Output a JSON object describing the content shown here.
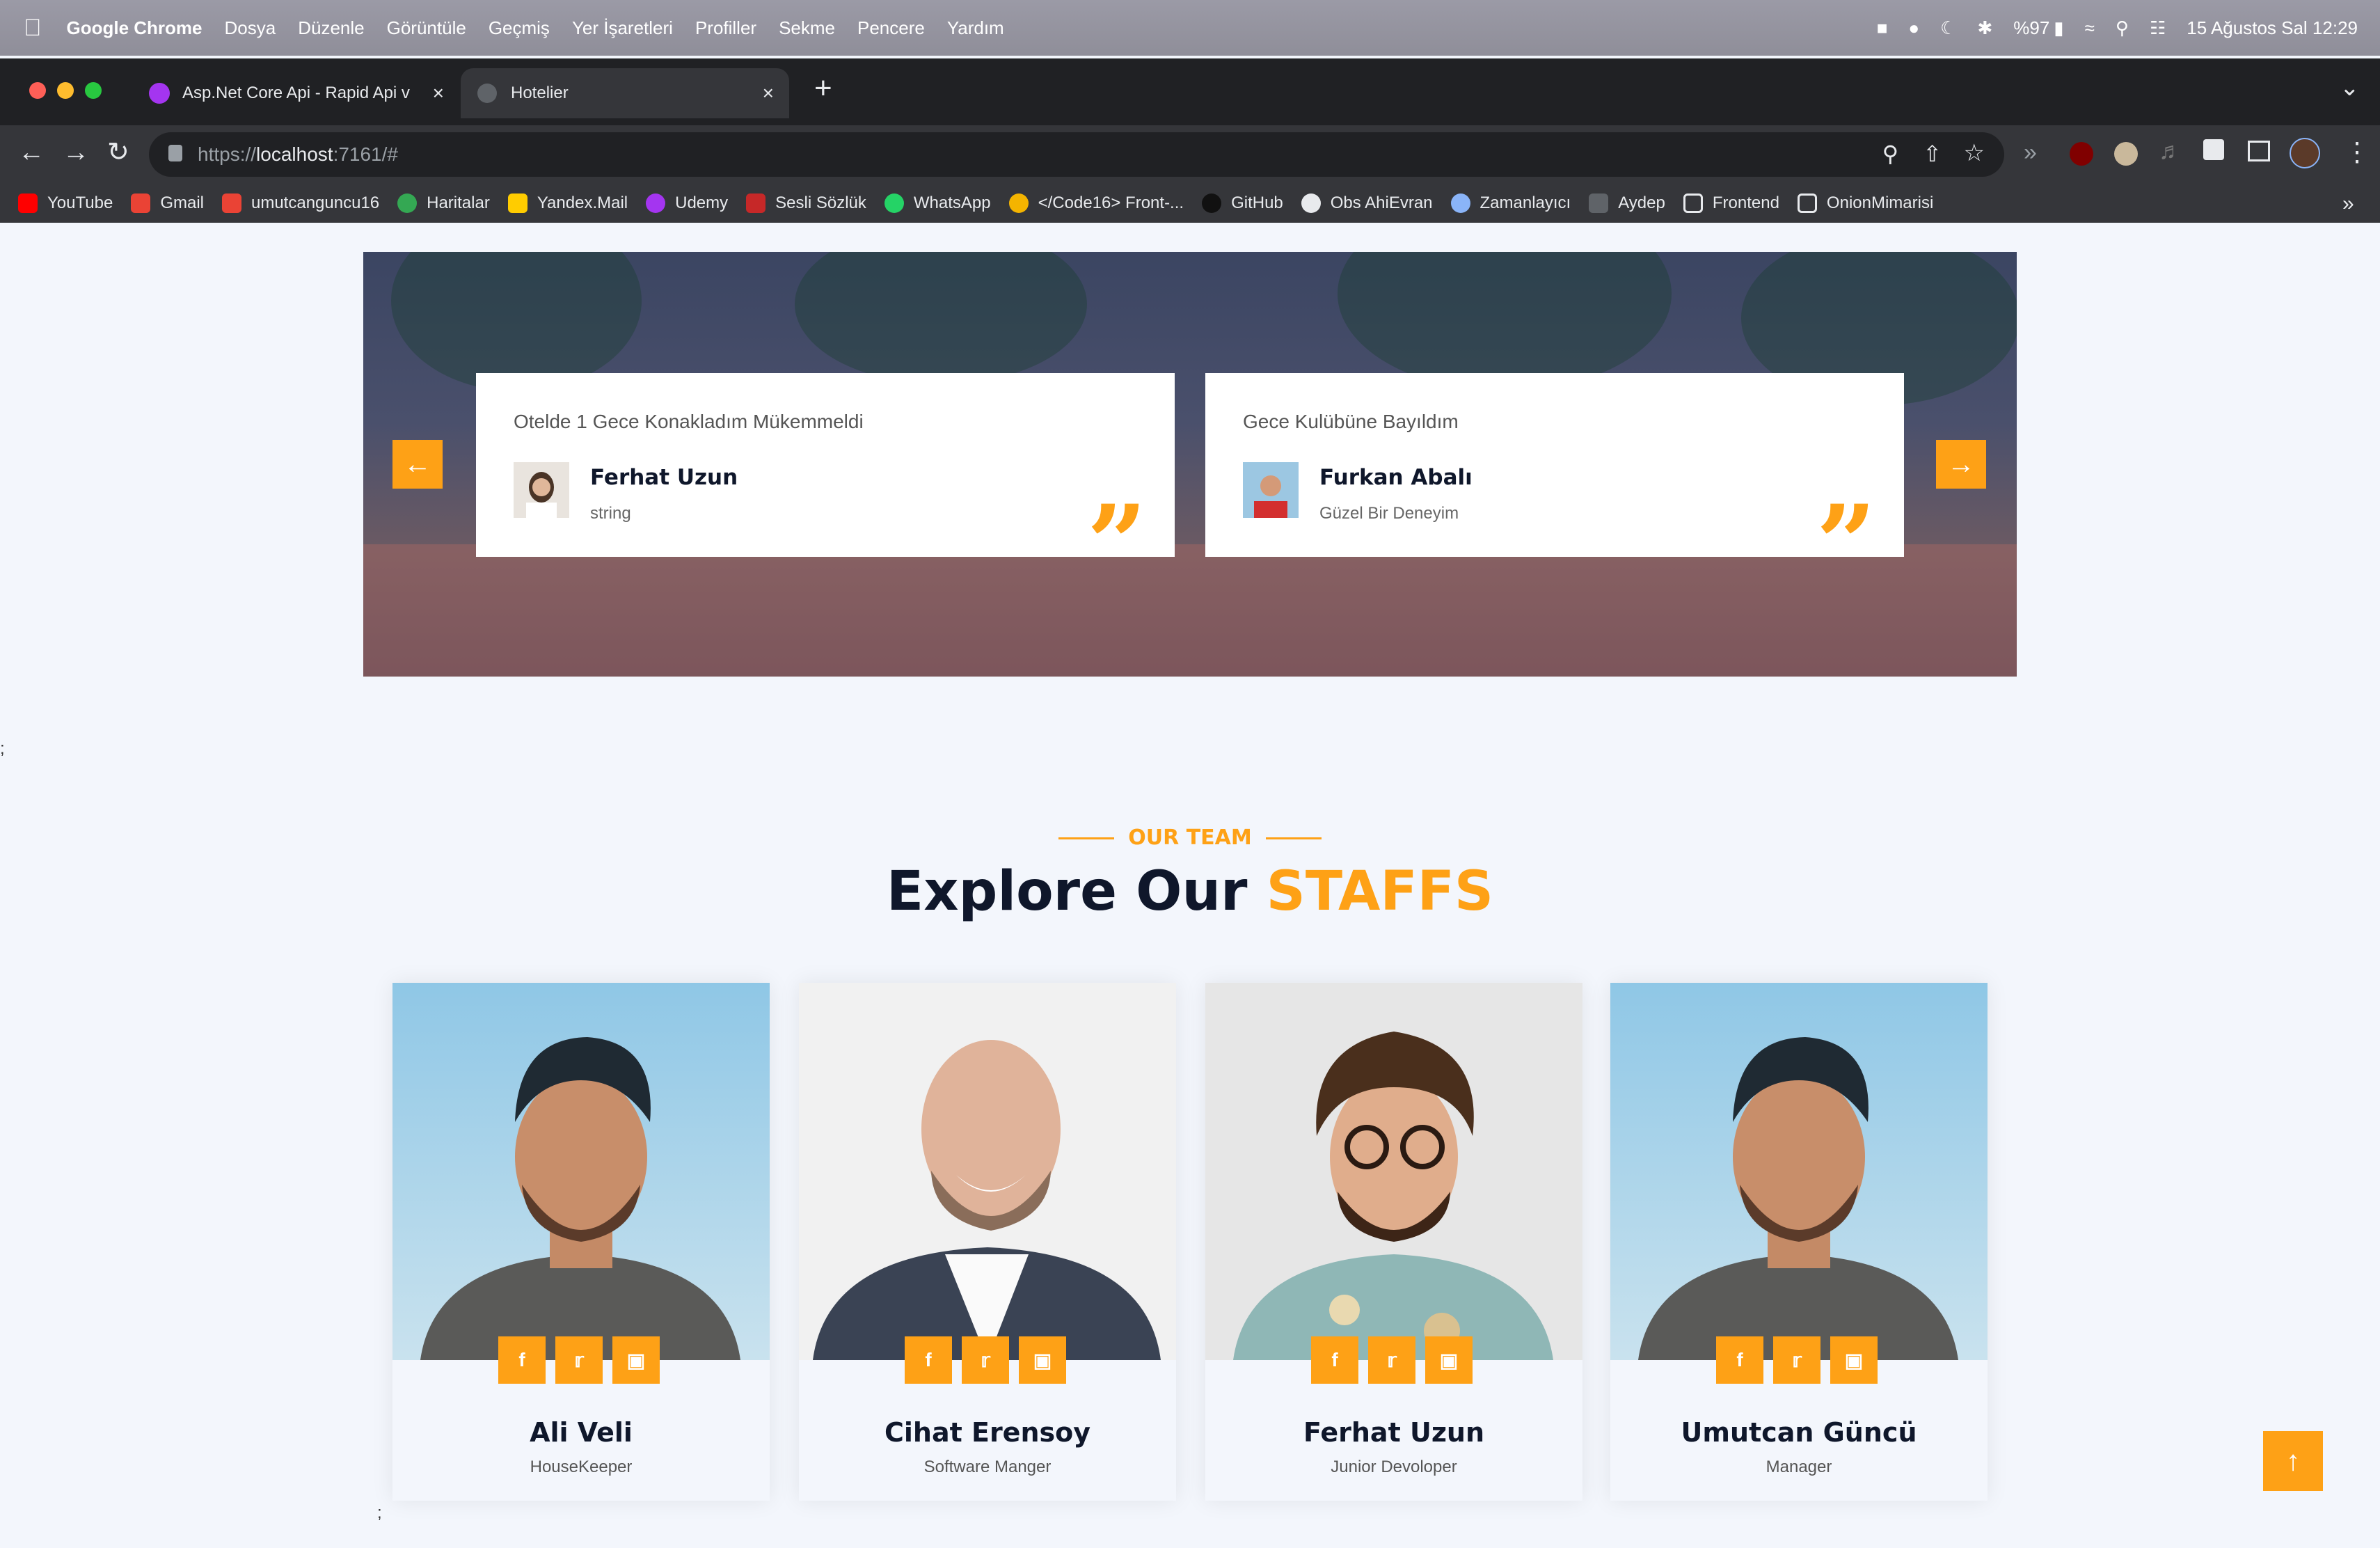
{
  "macos_menu": {
    "app": "Google Chrome",
    "items": [
      "Dosya",
      "Düzenle",
      "Görüntüle",
      "Geçmiş",
      "Yer İşaretleri",
      "Profiller",
      "Sekme",
      "Pencere",
      "Yardım"
    ],
    "battery": "%97",
    "datetime": "15 Ağustos Sal  12:29"
  },
  "browser": {
    "tabs": [
      {
        "title": "Asp.Net Core Api - Rapid Api v"
      },
      {
        "title": "Hotelier"
      }
    ],
    "url_prefix": "https://",
    "url_host": "localhost",
    "url_rest": ":7161/#",
    "bookmarks": [
      "YouTube",
      "Gmail",
      "umutcanguncu16",
      "Haritalar",
      "Yandex.Mail",
      "Udemy",
      "Sesli Sözlük",
      "WhatsApp",
      "</Code16> Front-...",
      "GitHub",
      "Obs AhiEvran",
      "Zamanlayıcı",
      "Aydep",
      "Frontend",
      "OnionMimarisi"
    ]
  },
  "testimonials": [
    {
      "text": "Otelde 1 Gece Konakladım Mükemmeldi",
      "name": "Ferhat Uzun",
      "role": "string"
    },
    {
      "text": "Gece Kulübüne Bayıldım",
      "name": "Furkan Abalı",
      "role": "Güzel Bir Deneyim"
    }
  ],
  "stray_text": ";",
  "team": {
    "subtitle": "OUR TEAM",
    "title_main": "Explore Our",
    "title_accent": "STAFFS",
    "members": [
      {
        "name": "Ali Veli",
        "job": "HouseKeeper"
      },
      {
        "name": "Cihat Erensoy",
        "job": "Software Manger"
      },
      {
        "name": "Ferhat Uzun",
        "job": "Junior Devoloper"
      },
      {
        "name": "Umutcan Güncü",
        "job": "Manager"
      }
    ]
  },
  "colors": {
    "accent": "#fea116",
    "dark": "#0f172b"
  }
}
